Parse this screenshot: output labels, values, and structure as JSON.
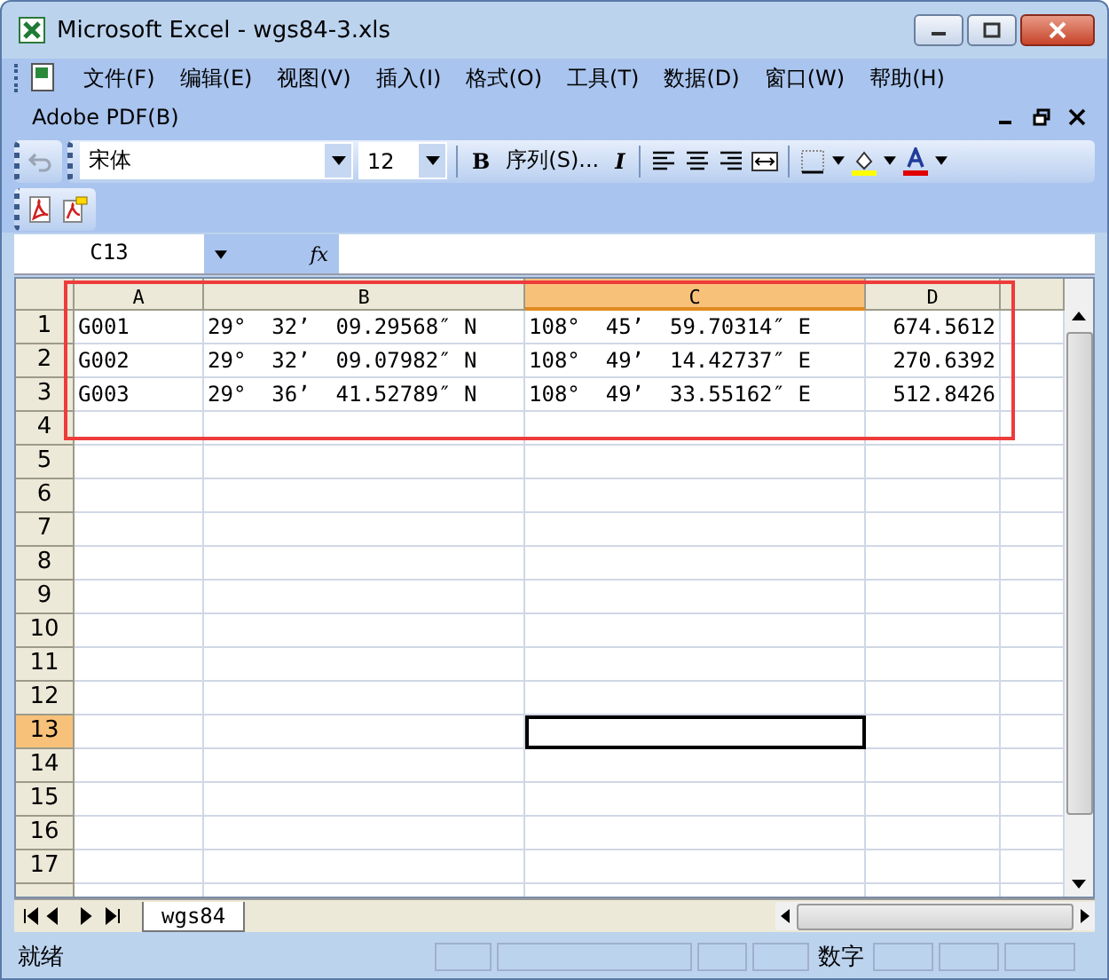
{
  "window": {
    "title": "Microsoft Excel - wgs84-3.xls"
  },
  "menu": [
    "文件(F)",
    "编辑(E)",
    "视图(V)",
    "插入(I)",
    "格式(O)",
    "工具(T)",
    "数据(D)",
    "窗口(W)",
    "帮助(H)"
  ],
  "menu2": [
    "Adobe PDF(B)"
  ],
  "toolbar": {
    "font": "宋体",
    "size": "12",
    "bold": "B",
    "sequence": "序列(S)...",
    "italic": "I"
  },
  "name_box": "C13",
  "formula_label": "fx",
  "columns": [
    {
      "label": "A",
      "selected": false
    },
    {
      "label": "B",
      "selected": false
    },
    {
      "label": "C",
      "selected": true
    },
    {
      "label": "D",
      "selected": false
    }
  ],
  "rows": [
    {
      "label": "1",
      "selected": false,
      "cells": [
        "G001",
        "29°  32’  09.29568″ N",
        "108°  45’  59.70314″ E",
        "674.5612"
      ]
    },
    {
      "label": "2",
      "selected": false,
      "cells": [
        "G002",
        "29°  32’  09.07982″ N",
        "108°  49’  14.42737″ E",
        "270.6392"
      ]
    },
    {
      "label": "3",
      "selected": false,
      "cells": [
        "G003",
        "29°  36’  41.52789″ N",
        "108°  49’  33.55162″ E",
        "512.8426"
      ]
    },
    {
      "label": "4",
      "selected": false,
      "cells": []
    },
    {
      "label": "5",
      "selected": false,
      "cells": []
    },
    {
      "label": "6",
      "selected": false,
      "cells": []
    },
    {
      "label": "7",
      "selected": false,
      "cells": []
    },
    {
      "label": "8",
      "selected": false,
      "cells": []
    },
    {
      "label": "9",
      "selected": false,
      "cells": []
    },
    {
      "label": "10",
      "selected": false,
      "cells": []
    },
    {
      "label": "11",
      "selected": false,
      "cells": []
    },
    {
      "label": "12",
      "selected": false,
      "cells": []
    },
    {
      "label": "13",
      "selected": true,
      "cells": []
    },
    {
      "label": "14",
      "selected": false,
      "cells": []
    },
    {
      "label": "15",
      "selected": false,
      "cells": []
    },
    {
      "label": "16",
      "selected": false,
      "cells": []
    },
    {
      "label": "17",
      "selected": false,
      "cells": []
    }
  ],
  "sheet_tabs": [
    {
      "label": "wgs84",
      "selected": true
    }
  ],
  "status_bar": {
    "status": "就绪",
    "mode": "数字"
  }
}
